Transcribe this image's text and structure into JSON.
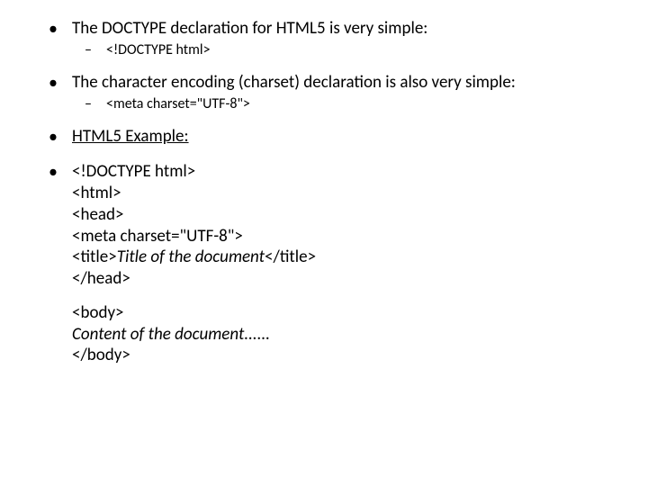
{
  "bullets": {
    "doctype_intro": "The DOCTYPE declaration for HTML5 is very simple:",
    "doctype_code": "<!DOCTYPE html>",
    "charset_intro": "The character encoding (charset) declaration is also very simple:",
    "charset_code": "<meta charset=\"UTF-8\">",
    "example_heading": "HTML5 Example:",
    "code": {
      "l1": "<!DOCTYPE html>",
      "l2": "<html>",
      "l3": "<head>",
      "l4": "<meta charset=\"UTF-8\">",
      "l5a": "<title>",
      "l5b": "Title of the document",
      "l5c": "</title>",
      "l6": "</head>",
      "l7": "<body>",
      "l8": "Content of the document......",
      "l9": "</body>"
    }
  }
}
